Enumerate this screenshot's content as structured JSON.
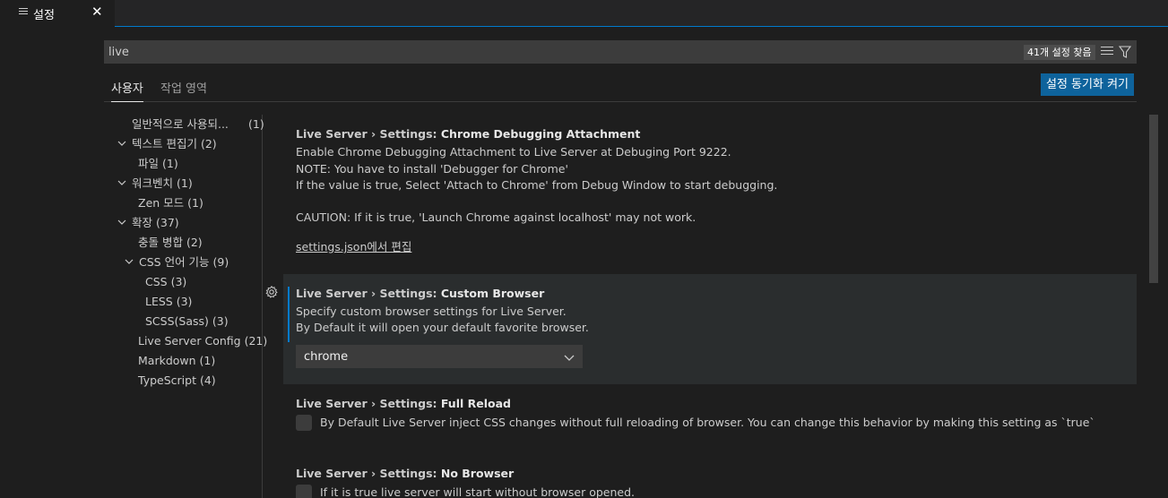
{
  "tab": {
    "label": "설정",
    "icon": "settings-list-icon",
    "close": "✕"
  },
  "search": {
    "value": "live",
    "result_count": "41개 설정 찾음"
  },
  "scope_tabs": [
    {
      "label": "사용자",
      "active": true
    },
    {
      "label": "작업 영역",
      "active": false
    }
  ],
  "sync_button": "설정 동기화 켜기",
  "toc": [
    {
      "label": "일반적으로 사용되...",
      "count": "(1)"
    },
    {
      "label": "텍스트 편집기",
      "count": "(2)",
      "expanded": true
    },
    {
      "label": "파일",
      "count": "(1)"
    },
    {
      "label": "워크벤치",
      "count": "(1)",
      "expanded": true
    },
    {
      "label": "Zen 모드",
      "count": "(1)"
    },
    {
      "label": "확장",
      "count": "(37)",
      "expanded": true
    },
    {
      "label": "충돌 병합",
      "count": "(2)"
    },
    {
      "label": "CSS 언어 기능",
      "count": "(9)",
      "expanded": true
    },
    {
      "label": "CSS",
      "count": "(3)"
    },
    {
      "label": "LESS",
      "count": "(3)"
    },
    {
      "label": "SCSS(Sass)",
      "count": "(3)"
    },
    {
      "label": "Live Server Config",
      "count": "(21)"
    },
    {
      "label": "Markdown",
      "count": "(1)"
    },
    {
      "label": "TypeScript",
      "count": "(4)"
    }
  ],
  "settings": [
    {
      "category": "Live Server › Settings: ",
      "name": "Chrome Debugging Attachment",
      "description": [
        "Enable Chrome Debugging Attachment to Live Server at Debuging Port 9222.",
        "NOTE: You have to install 'Debugger for Chrome'",
        "If the value is true, Select 'Attach to Chrome' from Debug Window to start debugging.",
        "CAUTION: If it is true, 'Launch Chrome against localhost' may not work."
      ],
      "link": "settings.json에서 편집"
    },
    {
      "category": "Live Server › Settings: ",
      "name": "Custom Browser",
      "description": [
        "Specify custom browser settings for Live Server.",
        "By Default it will open your default favorite browser."
      ],
      "value": "chrome"
    },
    {
      "category": "Live Server › Settings: ",
      "name": "Full Reload",
      "checkbox_label": "By Default Live Server inject CSS changes without full reloading of browser. You can change this behavior by making this setting as `true`",
      "checked": false
    },
    {
      "category": "Live Server › Settings: ",
      "name": "No Browser",
      "checkbox_label": "If it is true live server will start without browser opened.",
      "checked": false
    }
  ],
  "colors": {
    "accent": "#007acc",
    "button": "#0e639c",
    "background": "#1e1e1e"
  }
}
